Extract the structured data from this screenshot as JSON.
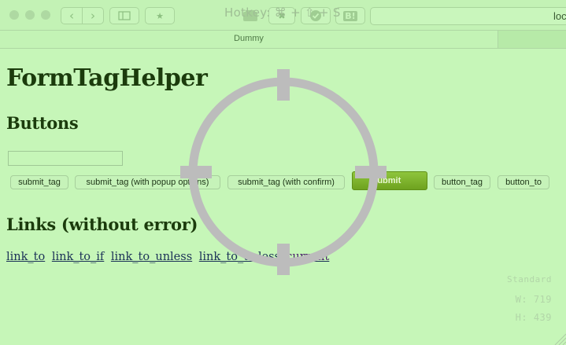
{
  "browser": {
    "hotkey_text": "Hotkey: ⌘ + ⇧ + S",
    "address_text": "loc",
    "tab_title": "Dummy"
  },
  "page": {
    "title": "FormTagHelper",
    "buttons_heading": "Buttons",
    "links_heading": "Links (without error)",
    "text_field_value": "",
    "buttons": [
      "submit_tag",
      "submit_tag (with popup options)",
      "submit_tag (with confirm)",
      "Submit",
      "button_tag",
      "button_to"
    ],
    "links": [
      "link_to",
      "link_to_if",
      "link_to_unless",
      "link_to_unless"
    ],
    "current_link": "current"
  },
  "overlay": {
    "preset": "Standard",
    "width_label": "W: 719",
    "height_label": "H: 439"
  },
  "colors": {
    "background": "#c6f6b8",
    "heading": "#1b3b0c",
    "submit": "#7cb32a",
    "crosshair": "#bcbcbc"
  }
}
